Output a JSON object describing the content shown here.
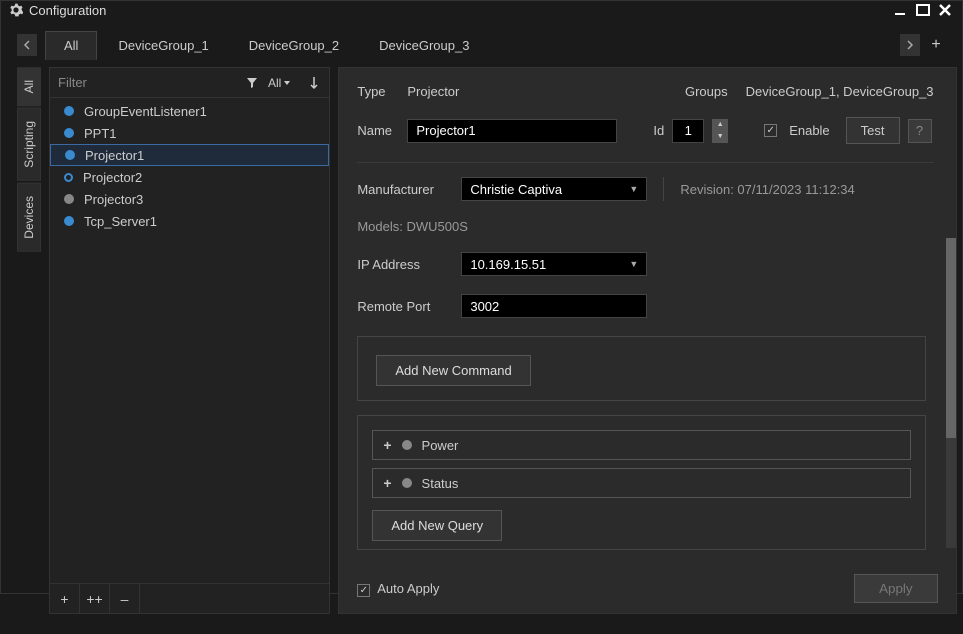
{
  "window": {
    "title": "Configuration"
  },
  "tabs": {
    "items": [
      "All",
      "DeviceGroup_1",
      "DeviceGroup_2",
      "DeviceGroup_3"
    ],
    "active": 0
  },
  "sideTabs": {
    "items": [
      "All",
      "Scripting",
      "Devices"
    ],
    "active": 0
  },
  "filter": {
    "placeholder": "Filter",
    "modeLabel": "All"
  },
  "devices": {
    "items": [
      {
        "name": "GroupEventListener1",
        "status": "blue"
      },
      {
        "name": "PPT1",
        "status": "blue"
      },
      {
        "name": "Projector1",
        "status": "blue",
        "selected": true
      },
      {
        "name": "Projector2",
        "status": "blue-outline"
      },
      {
        "name": "Projector3",
        "status": "gray"
      },
      {
        "name": "Tcp_Server1",
        "status": "blue"
      }
    ]
  },
  "footerButtons": {
    "add": "+",
    "addMulti": "++",
    "remove": "–"
  },
  "props": {
    "typeLabel": "Type",
    "typeValue": "Projector",
    "groupsLabel": "Groups",
    "groupsValue": "DeviceGroup_1, DeviceGroup_3",
    "nameLabel": "Name",
    "nameValue": "Projector1",
    "idLabel": "Id",
    "idValue": "1",
    "enableLabel": "Enable",
    "testLabel": "Test",
    "helpLabel": "?",
    "manufacturerLabel": "Manufacturer",
    "manufacturerValue": "Christie Captiva",
    "revisionLabel": "Revision: 07/11/2023 11:12:34",
    "modelsLabel": "Models: DWU500S",
    "ipLabel": "IP Address",
    "ipValue": "10.169.15.51",
    "portLabel": "Remote Port",
    "portValue": "3002",
    "addCommandLabel": "Add New Command",
    "queries": [
      {
        "label": "Power"
      },
      {
        "label": "Status"
      }
    ],
    "addQueryLabel": "Add New Query",
    "autoApplyLabel": "Auto Apply",
    "applyLabel": "Apply"
  }
}
